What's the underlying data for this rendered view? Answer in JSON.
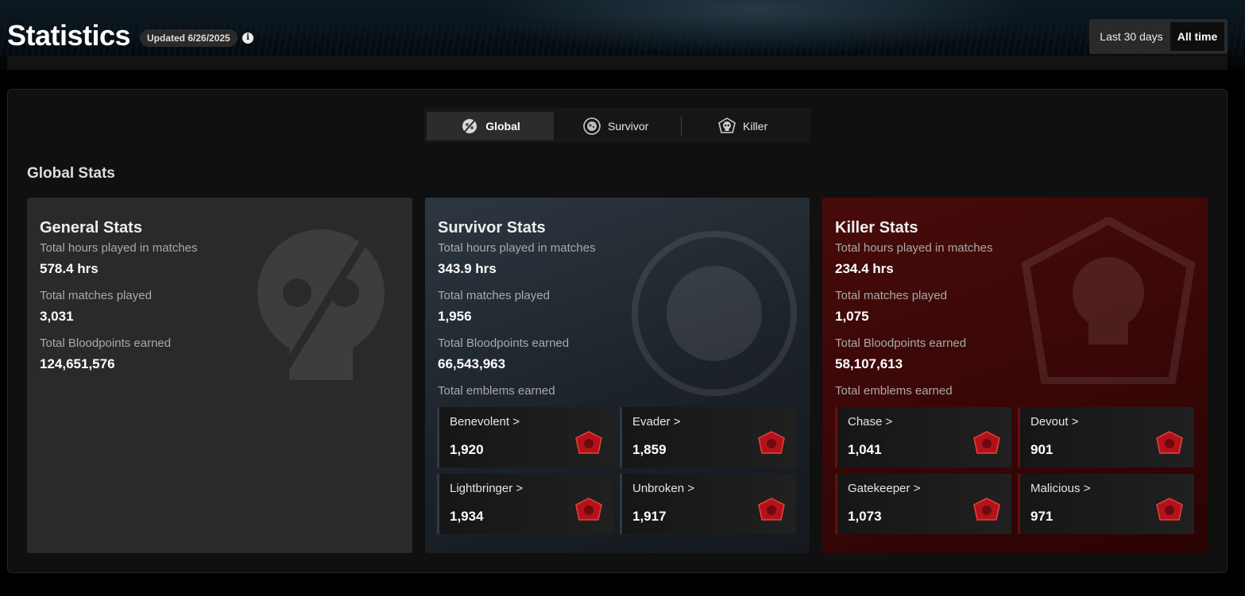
{
  "header": {
    "title": "Statistics",
    "updated": "Updated 6/26/2025",
    "info_icon": "info-icon",
    "range": {
      "options": [
        "Last 30 days",
        "All time"
      ],
      "selected": "All time"
    }
  },
  "tabs": [
    {
      "label": "Global",
      "icon": "global-icon",
      "active": true
    },
    {
      "label": "Survivor",
      "icon": "survivor-icon",
      "active": false
    },
    {
      "label": "Killer",
      "icon": "killer-icon",
      "active": false
    }
  ],
  "section_title": "Global Stats",
  "cards": {
    "general": {
      "title": "General Stats",
      "stats": [
        {
          "label": "Total hours played in matches",
          "value": "578.4 hrs"
        },
        {
          "label": "Total matches played",
          "value": "3,031"
        },
        {
          "label": "Total Bloodpoints earned",
          "value": "124,651,576"
        }
      ]
    },
    "survivor": {
      "title": "Survivor Stats",
      "stats": [
        {
          "label": "Total hours played in matches",
          "value": "343.9 hrs"
        },
        {
          "label": "Total matches played",
          "value": "1,956"
        },
        {
          "label": "Total Bloodpoints earned",
          "value": "66,543,963"
        }
      ],
      "emblems_label": "Total emblems earned",
      "emblems": [
        {
          "name": "Benevolent",
          "value": "1,920"
        },
        {
          "name": "Evader",
          "value": "1,859"
        },
        {
          "name": "Lightbringer",
          "value": "1,934"
        },
        {
          "name": "Unbroken",
          "value": "1,917"
        }
      ]
    },
    "killer": {
      "title": "Killer Stats",
      "stats": [
        {
          "label": "Total hours played in matches",
          "value": "234.4 hrs"
        },
        {
          "label": "Total matches played",
          "value": "1,075"
        },
        {
          "label": "Total Bloodpoints earned",
          "value": "58,107,613"
        }
      ],
      "emblems_label": "Total emblems earned",
      "emblems": [
        {
          "name": "Chase",
          "value": "1,041"
        },
        {
          "name": "Devout",
          "value": "901"
        },
        {
          "name": "Gatekeeper",
          "value": "1,073"
        },
        {
          "name": "Malicious",
          "value": "971"
        }
      ]
    }
  },
  "chevron": ">",
  "colors": {
    "accent_red": "#b3121b",
    "survivor_bg": "#252e36",
    "killer_bg": "#3d0707",
    "general_bg": "#2a2a2a"
  }
}
